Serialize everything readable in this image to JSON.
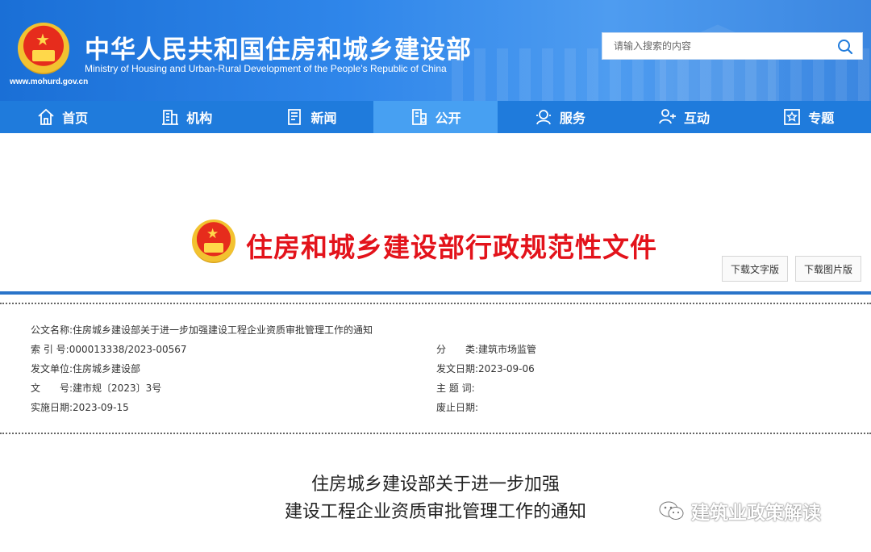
{
  "header": {
    "url": "www.mohurd.gov.cn",
    "title": "中华人民共和国住房和城乡建设部",
    "subtitle": "Ministry of Housing and Urban-Rural Development of the People’s Republic of China",
    "search_placeholder": "请输入搜索的内容"
  },
  "nav": {
    "items": [
      {
        "label": "首页",
        "icon": "home-icon"
      },
      {
        "label": "机构",
        "icon": "building-icon"
      },
      {
        "label": "新闻",
        "icon": "news-icon"
      },
      {
        "label": "公开",
        "icon": "document-icon",
        "active": true
      },
      {
        "label": "服务",
        "icon": "service-icon"
      },
      {
        "label": "互动",
        "icon": "interaction-icon"
      },
      {
        "label": "专题",
        "icon": "star-icon"
      }
    ]
  },
  "doc_header": {
    "heading": "住房和城乡建设部行政规范性文件",
    "download_text": "下载文字版",
    "download_image": "下载图片版"
  },
  "meta": {
    "name_label": "公文名称:",
    "name_value": "住房城乡建设部关于进一步加强建设工程企业资质审批管理工作的通知",
    "index_label": "索 引 号:",
    "index_value": "000013338/2023-00567",
    "category_label": "分　　类:",
    "category_value": "建筑市场监管",
    "issuer_label": "发文单位:",
    "issuer_value": "住房城乡建设部",
    "issue_date_label": "发文日期:",
    "issue_date_value": "2023-09-06",
    "doc_no_label": "文　　号:",
    "doc_no_value": "建市规〔2023〕3号",
    "subject_label": "主 题 词:",
    "subject_value": "",
    "effective_label": "实施日期:",
    "effective_value": "2023-09-15",
    "repeal_label": "废止日期:",
    "repeal_value": ""
  },
  "title": {
    "line1": "住房城乡建设部关于进一步加强",
    "line2": "建设工程企业资质审批管理工作的通知"
  },
  "watermark": "建筑业政策解读",
  "colors": {
    "banner": "#2f86ea",
    "nav": "#1f7bdc",
    "nav_active": "#47a0f2",
    "heading_red": "#e3131b",
    "rule_blue": "#2a74c9"
  }
}
